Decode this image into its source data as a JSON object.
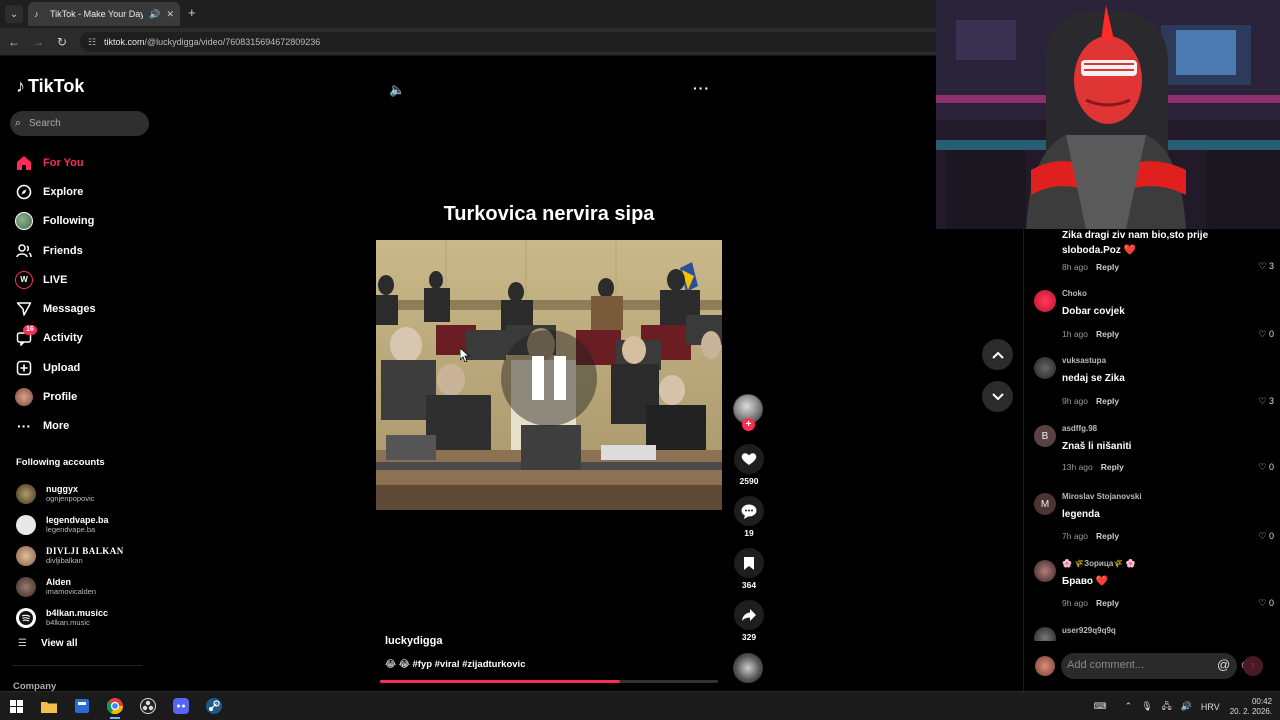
{
  "browser": {
    "tab_title": "TikTok - Make Your Day",
    "url_host": "tiktok.com",
    "url_path": "/@luckydigga/video/7608315694672809236"
  },
  "sidebar": {
    "logo": "TikTok",
    "search_placeholder": "Search",
    "nav": [
      {
        "label": "For You",
        "icon": "home-icon"
      },
      {
        "label": "Explore",
        "icon": "compass-icon"
      },
      {
        "label": "Following",
        "icon": "following-avatar-icon"
      },
      {
        "label": "Friends",
        "icon": "friends-icon"
      },
      {
        "label": "LIVE",
        "icon": "live-icon"
      },
      {
        "label": "Messages",
        "icon": "messages-icon"
      },
      {
        "label": "Activity",
        "icon": "activity-icon",
        "badge": "16"
      },
      {
        "label": "Upload",
        "icon": "upload-icon"
      },
      {
        "label": "Profile",
        "icon": "profile-avatar-icon"
      },
      {
        "label": "More",
        "icon": "more-dots-icon"
      }
    ],
    "following_heading": "Following accounts",
    "following": [
      {
        "name": "nuggyx",
        "handle": "ognjenpopovic"
      },
      {
        "name": "legendvape.ba",
        "handle": "legendvape.ba"
      },
      {
        "name": "DIVLJI BALKAN",
        "handle": "divljibalkan"
      },
      {
        "name": "Alden",
        "handle": "imamovicalden"
      },
      {
        "name": "b4lkan.musicc",
        "handle": "b4lkan.music"
      }
    ],
    "view_all": "View all",
    "company": "Company"
  },
  "video": {
    "title": "Turkovica nervira sipa",
    "author": "luckydigga",
    "caption": "😂 😂 #fyp #viral #zijadturkovic",
    "progress": 0.71,
    "likes": "2590",
    "comments": "19",
    "saves": "364",
    "shares": "329"
  },
  "comments": [
    {
      "user": "",
      "text": "Zika dragi ziv nam bio,sto prije sloboda.Poz",
      "heart": "❤️",
      "time": "8h ago",
      "reply": "Reply",
      "likes": "3",
      "avatar": ""
    },
    {
      "user": "Choko",
      "text": "Dobar covjek",
      "time": "1h ago",
      "reply": "Reply",
      "likes": "0",
      "avatar": ""
    },
    {
      "user": "vuksastupa",
      "text": "nedaj se Zika",
      "time": "9h ago",
      "reply": "Reply",
      "likes": "3",
      "avatar": ""
    },
    {
      "user": "asdffg.98",
      "text": "Znaš li nišaniti",
      "time": "13h ago",
      "reply": "Reply",
      "likes": "0",
      "avatar": "B"
    },
    {
      "user": "Miroslav Stojanovski",
      "text": "legenda",
      "time": "7h ago",
      "reply": "Reply",
      "likes": "0",
      "avatar": "M"
    },
    {
      "user": "🌸 🌾Зорица🌾 🌸",
      "text": "Браво",
      "heart": "❤️",
      "time": "9h ago",
      "reply": "Reply",
      "likes": "0",
      "avatar": ""
    },
    {
      "user": "user929q9q9q",
      "text": "",
      "time": "",
      "reply": "",
      "likes": "",
      "avatar": ""
    }
  ],
  "add_comment_placeholder": "Add comment...",
  "taskbar": {
    "lang": "HRV",
    "time": "00:42",
    "date": "20. 2. 2026."
  },
  "colors": {
    "accent": "#fe2c55",
    "background": "#000000"
  }
}
